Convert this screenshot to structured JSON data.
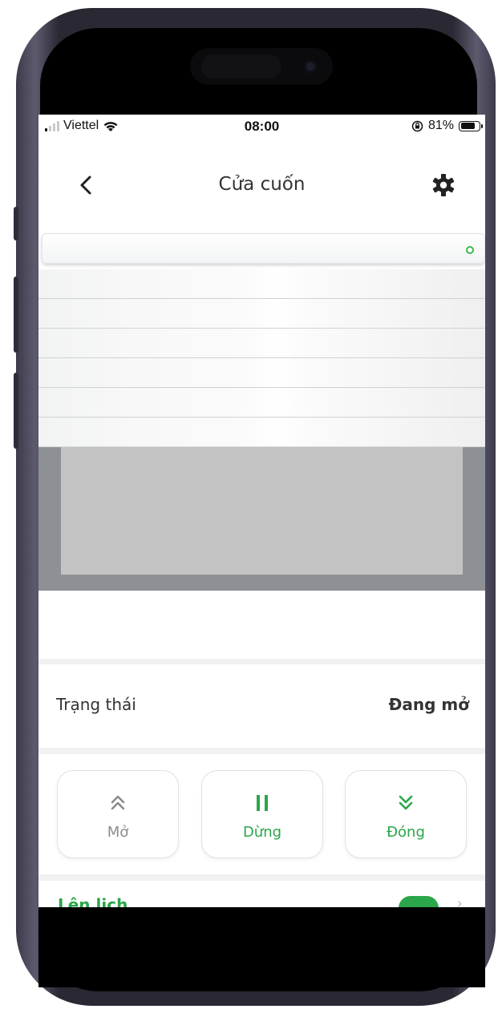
{
  "status_bar": {
    "carrier": "Viettel",
    "time": "08:00",
    "battery": "81%",
    "battery_level": 0.81
  },
  "nav": {
    "title": "Cửa cuốn",
    "back_icon": "chevron-left-icon",
    "settings_icon": "gear-icon"
  },
  "shutter": {
    "slat_count": 6,
    "indicator_color": "#3dba4b"
  },
  "status": {
    "label": "Trạng thái",
    "value": "Đang mở"
  },
  "controls": {
    "open": {
      "label": "Mở",
      "icon": "double-chevron-up-icon"
    },
    "stop": {
      "label": "Dừng",
      "icon": "pause-icon"
    },
    "close": {
      "label": "Đóng",
      "icon": "double-chevron-down-icon"
    }
  },
  "schedule": {
    "label": "Lên lịch",
    "toggle_on": true
  },
  "colors": {
    "accent": "#2ba64a",
    "inactive": "#8c8c8c"
  }
}
